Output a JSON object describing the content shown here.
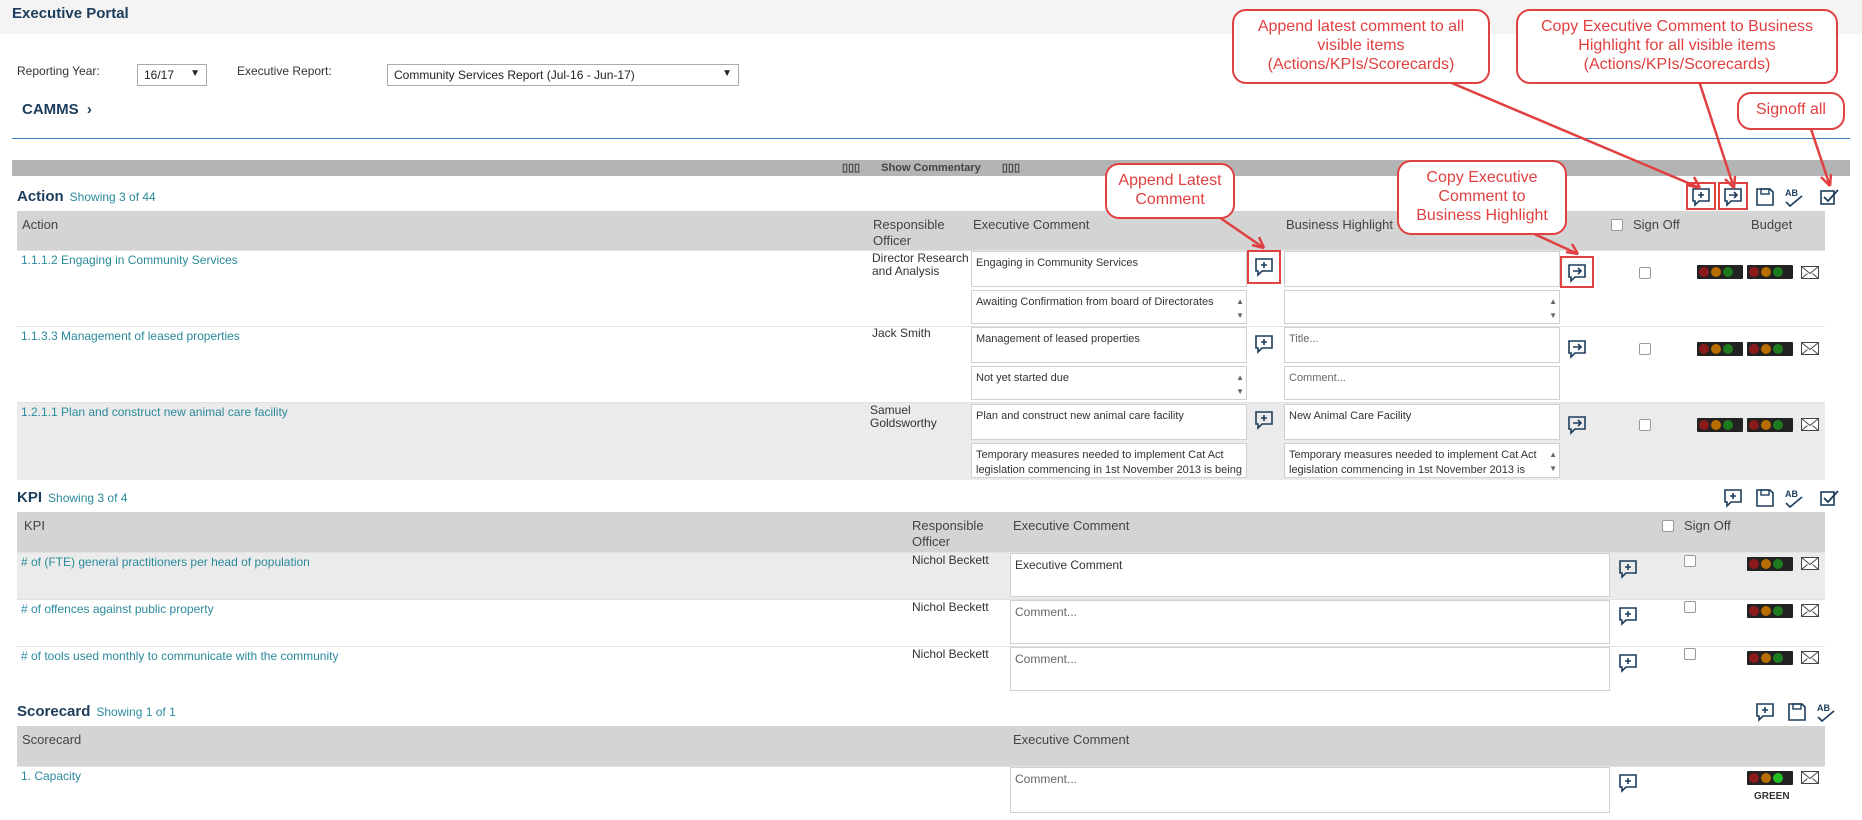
{
  "app": {
    "title": "Executive Portal"
  },
  "filters": {
    "reporting_year_label": "Reporting Year:",
    "reporting_year_value": "16/17",
    "executive_report_label": "Executive Report:",
    "executive_report_value": "Community Services Report (Jul-16 - Jun-17)"
  },
  "breadcrumb": {
    "label": "CAMMS"
  },
  "commentary_bar": {
    "label": "Show Commentary"
  },
  "action": {
    "title": "Action",
    "count": "Showing 3 of 44",
    "headers": {
      "name": "Action",
      "officer": "Responsible Officer",
      "exec_comment": "Executive Comment",
      "business_highlight": "Business Highlight",
      "sign_off": "Sign Off",
      "budget": "Budget"
    },
    "rows": [
      {
        "name": "1.1.1.2 Engaging in Community Services",
        "officer": "Director Research and Analysis",
        "exec_title": "Engaging in Community Services",
        "exec_comment": "Awaiting Confirmation from board of Directorates",
        "bh_title": "",
        "bh_comment": ""
      },
      {
        "name": "1.1.3.3 Management of leased properties",
        "officer": "Jack Smith",
        "exec_title": "Management of leased properties",
        "exec_comment": "Not yet started due",
        "bh_title": "Title...",
        "bh_comment": "Comment..."
      },
      {
        "name": "1.2.1.1 Plan and construct new animal care facility",
        "officer": "Samuel Goldsworthy",
        "exec_title": "Plan and construct new animal care facility",
        "exec_comment": "Temporary measures needed to implement Cat Act legislation commencing in 1st November 2013 is being",
        "bh_title": "New Animal Care Facility",
        "bh_comment": "Temporary measures needed to implement Cat Act legislation commencing in 1st November 2013 is"
      }
    ]
  },
  "kpi": {
    "title": "KPI",
    "count": "Showing 3 of 4",
    "headers": {
      "name": "KPI",
      "officer": "Responsible Officer",
      "exec_comment": "Executive Comment",
      "sign_off": "Sign Off"
    },
    "rows": [
      {
        "name": "# of (FTE) general practitioners per head of population",
        "officer": "Nichol Beckett",
        "comment": "Executive Comment"
      },
      {
        "name": "# of offences against public property",
        "officer": "Nichol Beckett",
        "comment": "Comment..."
      },
      {
        "name": "# of tools used monthly to communicate with the community",
        "officer": "Nichol Beckett",
        "comment": "Comment..."
      }
    ]
  },
  "scorecard": {
    "title": "Scorecard",
    "count": "Showing 1 of 1",
    "headers": {
      "name": "Scorecard",
      "exec_comment": "Executive Comment"
    },
    "rows": [
      {
        "name": "1. Capacity",
        "comment": "Comment...",
        "status": "GREEN"
      }
    ]
  },
  "toolbar_icons": [
    "append-all-icon",
    "copy-all-icon",
    "save-icon",
    "spellcheck-icon",
    "signoff-all-icon"
  ],
  "spellcheck_glyph": "AB",
  "callouts": {
    "append_all": "Append latest comment to all visible items (Actions/KPIs/Scorecards)",
    "copy_all": "Copy Executive Comment to Business Highlight for all visible items (Actions/KPIs/Scorecards)",
    "signoff_all": "Signoff all",
    "append_latest": "Append Latest Comment",
    "copy_exec": "Copy Executive Comment to Business Highlight"
  },
  "colors": {
    "accent": "#1d3d5c",
    "link": "#2a8a9c",
    "callout": "#e04040",
    "red": "#8b1a1a",
    "amber": "#b86d00",
    "green": "#1e7a1e",
    "green_on": "#22c022"
  }
}
